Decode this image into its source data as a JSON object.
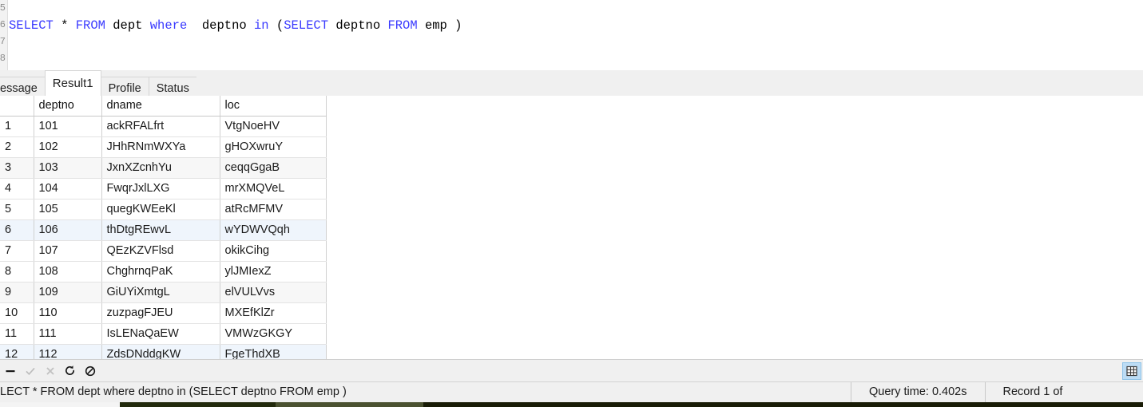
{
  "editor": {
    "gutter_numbers": [
      "5",
      "6",
      "7",
      "8"
    ],
    "sql_tokens": [
      {
        "t": "SELECT",
        "k": true
      },
      {
        "t": " * ",
        "k": false
      },
      {
        "t": "FROM",
        "k": true
      },
      {
        "t": " dept ",
        "k": false
      },
      {
        "t": "where",
        "k": true
      },
      {
        "t": "  deptno ",
        "k": false
      },
      {
        "t": "in",
        "k": true
      },
      {
        "t": " (",
        "k": false
      },
      {
        "t": "SELECT",
        "k": true
      },
      {
        "t": " deptno ",
        "k": false
      },
      {
        "t": "FROM",
        "k": true
      },
      {
        "t": " emp )",
        "k": false
      }
    ],
    "sql_text": "SELECT * FROM dept where  deptno in (SELECT deptno FROM emp )"
  },
  "tabs": [
    {
      "label": "essage",
      "active": false,
      "name": "tab-message"
    },
    {
      "label": "Result1",
      "active": true,
      "name": "tab-result1"
    },
    {
      "label": "Profile",
      "active": false,
      "name": "tab-profile"
    },
    {
      "label": "Status",
      "active": false,
      "name": "tab-status"
    }
  ],
  "grid": {
    "columns": [
      "",
      "deptno",
      "dname",
      "loc"
    ],
    "rows": [
      {
        "n": "1",
        "deptno": "101",
        "dname": "ackRFALfrt",
        "loc": "VtgNoeHV"
      },
      {
        "n": "2",
        "deptno": "102",
        "dname": "JHhRNmWXYa",
        "loc": "gHOXwruY"
      },
      {
        "n": "3",
        "deptno": "103",
        "dname": "JxnXZcnhYu",
        "loc": "ceqqGgaB"
      },
      {
        "n": "4",
        "deptno": "104",
        "dname": "FwqrJxlLXG",
        "loc": "mrXMQVeL"
      },
      {
        "n": "5",
        "deptno": "105",
        "dname": "quegKWEeKl",
        "loc": "atRcMFMV"
      },
      {
        "n": "6",
        "deptno": "106",
        "dname": "thDtgREwvL",
        "loc": "wYDWVQqh"
      },
      {
        "n": "7",
        "deptno": "107",
        "dname": "QEzKZVFlsd",
        "loc": "okikCihg"
      },
      {
        "n": "8",
        "deptno": "108",
        "dname": "ChghrnqPaK",
        "loc": "ylJMIexZ"
      },
      {
        "n": "9",
        "deptno": "109",
        "dname": "GiUYiXmtgL",
        "loc": "elVULVvs"
      },
      {
        "n": "10",
        "deptno": "110",
        "dname": "zuzpagFJEU",
        "loc": "MXEfKlZr"
      },
      {
        "n": "11",
        "deptno": "111",
        "dname": "IsLENaQaEW",
        "loc": "VMWzGKGY"
      },
      {
        "n": "12",
        "deptno": "112",
        "dname": "ZdsDNddgKW",
        "loc": "FgeThdXB"
      }
    ]
  },
  "toolbar": {
    "buttons": [
      {
        "name": "remove-record-button",
        "icon": "minus-icon",
        "enabled": true
      },
      {
        "name": "apply-change-button",
        "icon": "check-icon",
        "enabled": false
      },
      {
        "name": "cancel-change-button",
        "icon": "cross-icon",
        "enabled": false
      },
      {
        "name": "refresh-button",
        "icon": "refresh-icon",
        "enabled": true
      },
      {
        "name": "stop-button",
        "icon": "prohibit-icon",
        "enabled": true
      }
    ],
    "view_toggle": {
      "name": "grid-view-button",
      "icon": "grid-icon",
      "selected": true
    }
  },
  "statusbar": {
    "query": "LECT * FROM dept where  deptno in (SELECT deptno FROM emp )",
    "query_time": "Query time: 0.402s",
    "record_info": "Record 1 of"
  },
  "colors": {
    "keyword": "#3a3aff",
    "header_rownum_bg": "#d6e6f7",
    "selected_row_bg": "#eff5fc",
    "alt_row_bg": "#f7f7f7",
    "toolbar_bg": "#f0f0f0",
    "view_toggle_bg": "#bcdcf5"
  }
}
